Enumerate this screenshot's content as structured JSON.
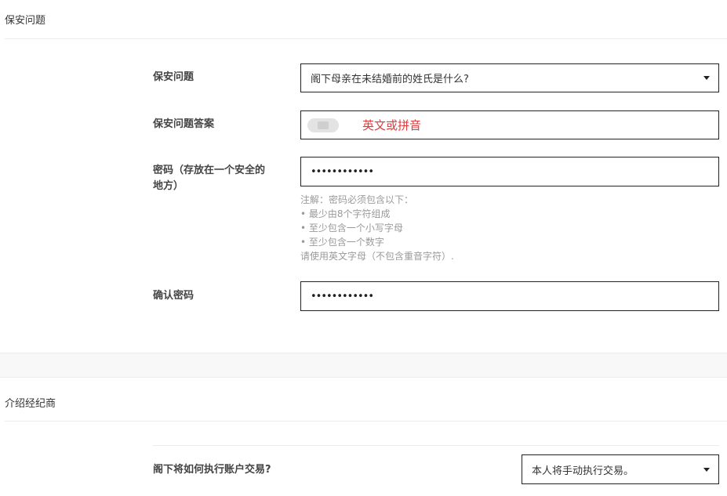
{
  "security_section": {
    "title": "保安问题",
    "question_label": "保安问题",
    "question_value": "阁下母亲在未结婚前的姓氏是什么?",
    "answer_label": "保安问题答案",
    "answer_hint": "英文或拼音",
    "password_label_line1": "密码（存放在一个安全的",
    "password_label_line2": "地方）",
    "password_value": "••••••••••••",
    "notes": [
      "注解：密码必须包含以下：",
      "• 最少由8个字符组成",
      "• 至少包含一个小写字母",
      "• 至少包含一个数字",
      "请使用英文字母（不包含重音字符）."
    ],
    "confirm_label": "确认密码",
    "confirm_value": "••••••••••••"
  },
  "broker_section": {
    "title": "介绍经纪商",
    "trade_label": "阁下将如何执行账户交易?",
    "trade_value": "本人将手动执行交易。"
  }
}
